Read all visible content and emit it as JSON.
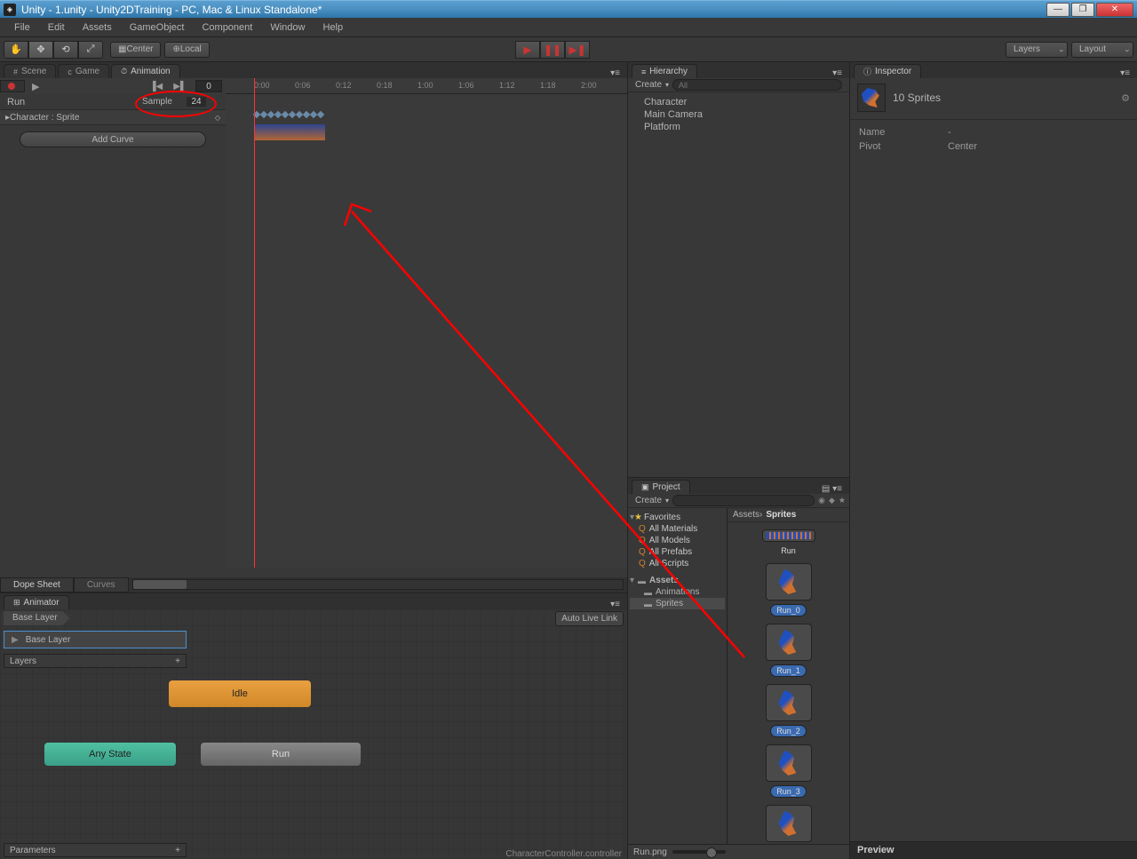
{
  "window": {
    "title": "Unity - 1.unity - Unity2DTraining - PC, Mac & Linux Standalone*"
  },
  "menu": [
    "File",
    "Edit",
    "Assets",
    "GameObject",
    "Component",
    "Window",
    "Help"
  ],
  "toolbar": {
    "center": "Center",
    "local": "Local",
    "layers": "Layers",
    "layout": "Layout"
  },
  "tabs": {
    "scene": "Scene",
    "game": "Game",
    "animation": "Animation",
    "animator": "Animator",
    "hierarchy": "Hierarchy",
    "project": "Project",
    "inspector": "Inspector"
  },
  "animation": {
    "clip": "Run",
    "sample_label": "Sample",
    "sample_value": "24",
    "frame": "0",
    "property": "Character : Sprite",
    "add_curve": "Add Curve",
    "dope": "Dope Sheet",
    "curves": "Curves",
    "ruler": [
      "0:00",
      "0:06",
      "0:12",
      "0:18",
      "1:00",
      "1:06",
      "1:12",
      "1:18",
      "2:00"
    ]
  },
  "animator": {
    "breadcrumb": "Base Layer",
    "autolive": "Auto Live Link",
    "layer": "Base Layer",
    "layers_label": "Layers",
    "params_label": "Parameters",
    "idle": "Idle",
    "any": "Any State",
    "run": "Run",
    "status": "CharacterController.controller"
  },
  "hierarchy": {
    "create": "Create",
    "search": "All",
    "items": [
      "Character",
      "Main Camera",
      "Platform"
    ]
  },
  "project": {
    "create": "Create",
    "favorites": "Favorites",
    "fav_items": [
      "All Materials",
      "All Models",
      "All Prefabs",
      "All Scripts"
    ],
    "assets": "Assets",
    "folders": [
      "Animations",
      "Sprites"
    ],
    "crumb_root": "Assets",
    "crumb_leaf": "Sprites",
    "run_atlas": "Run",
    "sprites": [
      "Run_0",
      "Run_1",
      "Run_2",
      "Run_3"
    ],
    "status": "Run.png",
    "preview": "Preview"
  },
  "inspector": {
    "title": "10 Sprites",
    "name_k": "Name",
    "name_v": "-",
    "pivot_k": "Pivot",
    "pivot_v": "Center"
  }
}
